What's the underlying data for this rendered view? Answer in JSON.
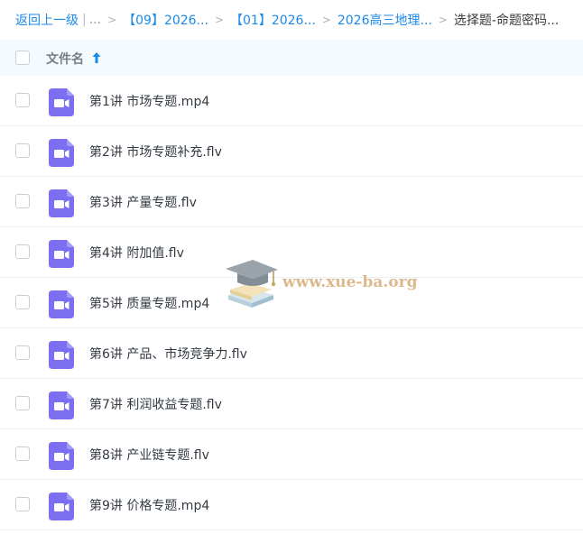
{
  "breadcrumb": {
    "back_label": "返回上一级",
    "ellipsis": "...",
    "items": [
      {
        "label": "【09】2026..."
      },
      {
        "label": "【01】2026..."
      },
      {
        "label": "2026高三地理..."
      }
    ],
    "current": "选择题-命题密码..."
  },
  "header": {
    "column_label": "文件名"
  },
  "files": [
    {
      "name": "第1讲 市场专题.mp4"
    },
    {
      "name": "第2讲 市场专题补充.flv"
    },
    {
      "name": "第3讲 产量专题.flv"
    },
    {
      "name": "第4讲 附加值.flv"
    },
    {
      "name": "第5讲 质量专题.mp4"
    },
    {
      "name": "第6讲 产品、市场竞争力.flv"
    },
    {
      "name": "第7讲 利润收益专题.flv"
    },
    {
      "name": "第8讲 产业链专题.flv"
    },
    {
      "name": "第9讲 价格专题.mp4"
    }
  ],
  "watermark": {
    "text": "www.xue-ba.org"
  },
  "colors": {
    "accent": "#1b8ae8",
    "video_icon": "#7b6ff0",
    "header_bg": "#f4fbff"
  }
}
